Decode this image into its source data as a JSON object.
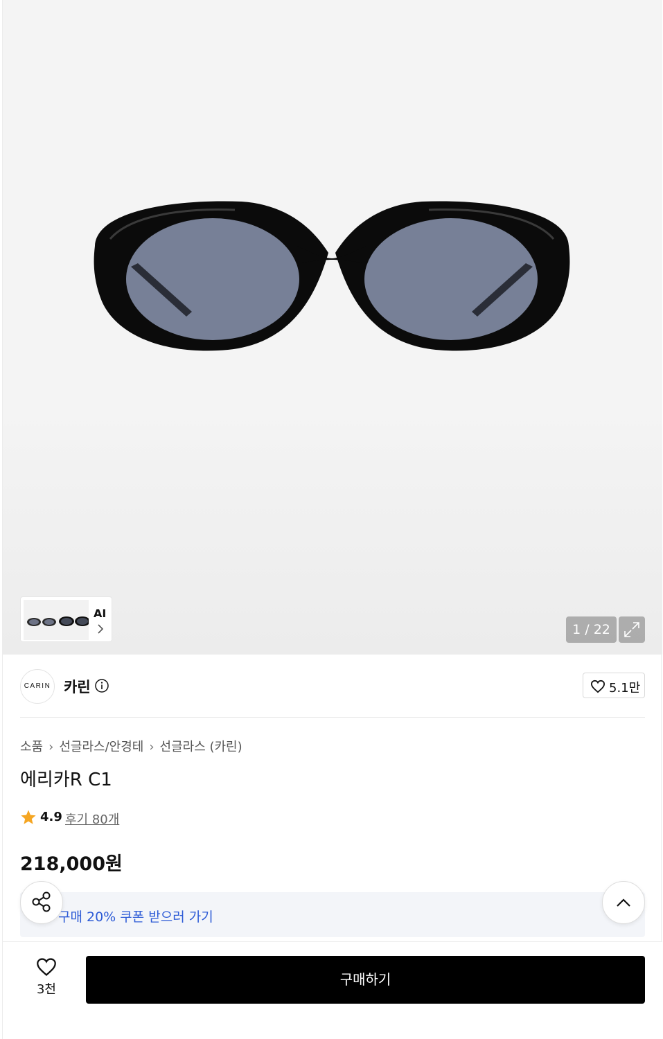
{
  "gallery": {
    "ai_label": "AI",
    "counter": "1 / 22"
  },
  "brand": {
    "logo_text": "CARIN",
    "name": "카린",
    "likes": "5.1만"
  },
  "breadcrumb": [
    "소품",
    "선글라스/안경테",
    "선글라스 (카린)"
  ],
  "product": {
    "title": "에리카R C1",
    "rating": "4.9",
    "reviews": "후기 80개",
    "price": "218,000원"
  },
  "coupon": {
    "text": "구매 20% 쿠폰 받으러 가기"
  },
  "bottom_bar": {
    "wish_count": "3천",
    "buy_label": "구매하기"
  },
  "colors": {
    "accent_blue": "#2d5bd6",
    "star": "#f5a623",
    "buy_button": "#000000"
  },
  "icons": [
    "expand-icon",
    "info-icon",
    "heart-icon",
    "chevron-right-icon",
    "star-icon",
    "share-icon",
    "chevron-up-icon"
  ]
}
